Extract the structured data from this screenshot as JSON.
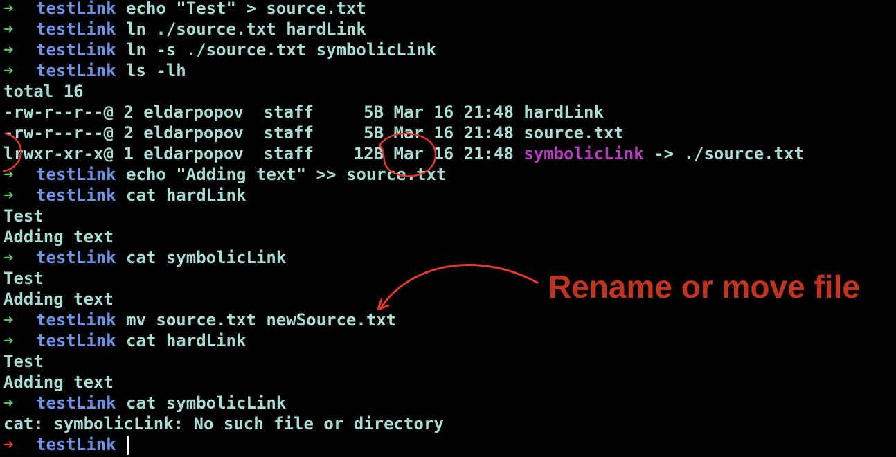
{
  "theme": {
    "background": "#000000",
    "text": "#a8ddd6",
    "prompt_ok": "#59c26b",
    "prompt_error": "#e8433a",
    "directory": "#6c93e8",
    "symlink": "#b53cbf",
    "annotation": "#c2341f"
  },
  "prompt": {
    "arrow": "➜",
    "directory": "testLink"
  },
  "lines": [
    {
      "kind": "prompt",
      "cmd": "echo \"Test\" > source.txt"
    },
    {
      "kind": "prompt",
      "cmd": "ln ./source.txt hardLink"
    },
    {
      "kind": "prompt",
      "cmd": "ln -s ./source.txt symbolicLink"
    },
    {
      "kind": "prompt",
      "cmd": "ls -lh"
    },
    {
      "kind": "output",
      "text": "total 16"
    },
    {
      "kind": "output",
      "text": "-rw-r--r--@ 2 eldarpopov  staff     5B Mar 16 21:48 hardLink"
    },
    {
      "kind": "output",
      "text": "-rw-r--r--@ 2 eldarpopov  staff     5B Mar 16 21:48 source.txt"
    },
    {
      "kind": "symlink",
      "prefix": "lrwxr-xr-x@ 1 eldarpopov  staff    12B Mar 16 21:48 ",
      "name": "symbolicLink",
      "suffix": " -> ./source.txt"
    },
    {
      "kind": "prompt",
      "cmd": "echo \"Adding text\" >> source.txt"
    },
    {
      "kind": "prompt",
      "cmd": "cat hardLink"
    },
    {
      "kind": "output",
      "text": "Test"
    },
    {
      "kind": "output",
      "text": "Adding text"
    },
    {
      "kind": "prompt",
      "cmd": "cat symbolicLink"
    },
    {
      "kind": "output",
      "text": "Test"
    },
    {
      "kind": "output",
      "text": "Adding text"
    },
    {
      "kind": "prompt",
      "cmd": "mv source.txt newSource.txt"
    },
    {
      "kind": "prompt",
      "cmd": "cat hardLink"
    },
    {
      "kind": "output",
      "text": "Test"
    },
    {
      "kind": "output",
      "text": "Adding text"
    },
    {
      "kind": "prompt",
      "cmd": "cat symbolicLink"
    },
    {
      "kind": "output",
      "text": "cat: symbolicLink: No such file or directory"
    },
    {
      "kind": "prompt-error",
      "cmd": ""
    }
  ],
  "annotation": {
    "text": "Rename or move file"
  }
}
